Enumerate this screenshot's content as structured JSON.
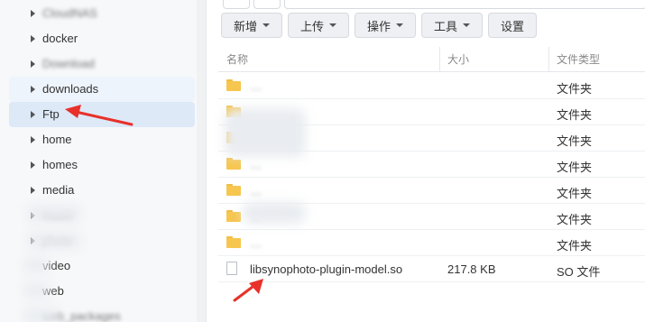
{
  "tree": {
    "items": [
      {
        "label": "CloudNAS",
        "blurred": true
      },
      {
        "label": "docker",
        "blurred": false
      },
      {
        "label": "Download",
        "blurred": true
      },
      {
        "label": "downloads",
        "blurred": false
      },
      {
        "label": "Ftp",
        "blurred": false,
        "selected": true
      },
      {
        "label": "home",
        "blurred": false
      },
      {
        "label": "homes",
        "blurred": false
      },
      {
        "label": "media",
        "blurred": false
      },
      {
        "label": "music",
        "blurred": true
      },
      {
        "label": "photo",
        "blurred": true
      },
      {
        "label": "video",
        "blurred": false
      },
      {
        "label": "web",
        "blurred": false
      },
      {
        "label": "web_packages",
        "blurred": true
      }
    ]
  },
  "toolbar": {
    "new_label": "新增",
    "upload_label": "上传",
    "action_label": "操作",
    "tools_label": "工具",
    "settings_label": "设置"
  },
  "columns": {
    "name": "名称",
    "size": "大小",
    "type": "文件类型"
  },
  "files": [
    {
      "name": "…",
      "size": "",
      "type": "文件夹",
      "kind": "folder",
      "blurred": true
    },
    {
      "name": "…",
      "size": "",
      "type": "文件夹",
      "kind": "folder",
      "blurred": true
    },
    {
      "name": "…",
      "size": "",
      "type": "文件夹",
      "kind": "folder",
      "blurred": true
    },
    {
      "name": "…",
      "size": "",
      "type": "文件夹",
      "kind": "folder",
      "blurred": true
    },
    {
      "name": "…",
      "size": "",
      "type": "文件夹",
      "kind": "folder",
      "blurred": true
    },
    {
      "name": "…",
      "size": "",
      "type": "文件夹",
      "kind": "folder",
      "blurred": true
    },
    {
      "name": "…",
      "size": "",
      "type": "文件夹",
      "kind": "folder",
      "blurred": true
    },
    {
      "name": "libsynophoto-plugin-model.so",
      "size": "217.8 KB",
      "type": "SO 文件",
      "kind": "file",
      "blurred": false
    }
  ],
  "colors": {
    "annotation_red": "#e8312a",
    "folder_yellow": "#f6c64f",
    "selection_blue": "#dde9f7"
  }
}
